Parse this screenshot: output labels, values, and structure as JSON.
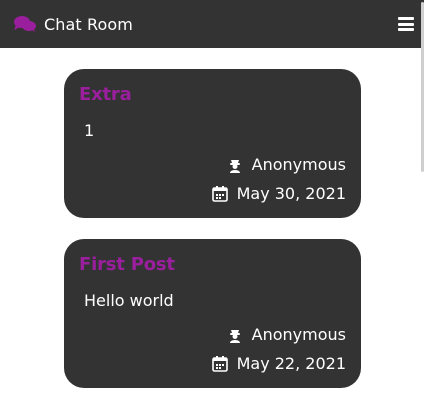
{
  "header": {
    "brand_icon": "comments-icon",
    "title": "Chat Room",
    "menu_icon": "hamburger-menu-icon"
  },
  "theme": {
    "navbar_bg": "#333333",
    "card_bg": "#333333",
    "accent": "#9a1f9d",
    "text": "#ffffff"
  },
  "posts": [
    {
      "title": "Extra",
      "body": "1",
      "author": "Anonymous",
      "author_icon": "user-secret-icon",
      "date": "May 30, 2021",
      "date_icon": "calendar-icon"
    },
    {
      "title": "First Post",
      "body": "Hello world",
      "author": "Anonymous",
      "author_icon": "user-secret-icon",
      "date": "May 22, 2021",
      "date_icon": "calendar-icon"
    }
  ]
}
